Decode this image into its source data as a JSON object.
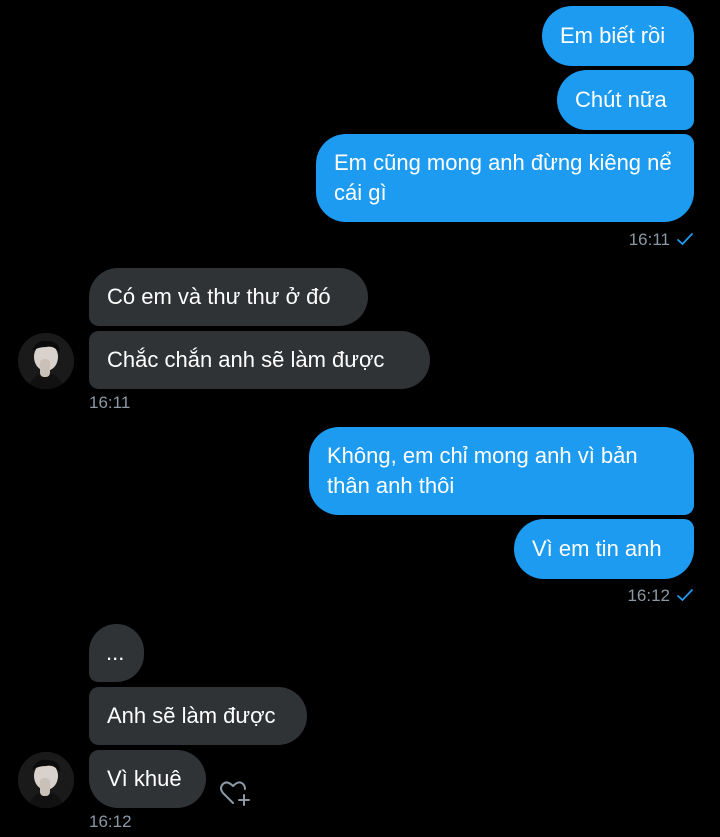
{
  "conversation": {
    "messages": [
      {
        "id": "m1",
        "from": "me",
        "text": "Em biết rồi"
      },
      {
        "id": "m2",
        "from": "me",
        "text": "Chút nữa"
      },
      {
        "id": "m3",
        "from": "me",
        "text": "Em cũng mong anh đừng kiêng nể cái gì"
      },
      {
        "id": "m4",
        "from": "them",
        "text": "Có em và thư thư ở đó"
      },
      {
        "id": "m5",
        "from": "them",
        "text": "Chắc chắn anh sẽ làm được"
      },
      {
        "id": "m6",
        "from": "me",
        "text": "Không, em chỉ mong anh vì bản thân anh thôi"
      },
      {
        "id": "m7",
        "from": "me",
        "text": "Vì em tin anh"
      },
      {
        "id": "m8",
        "from": "them",
        "text": "..."
      },
      {
        "id": "m9",
        "from": "them",
        "text": "Anh sẽ làm được"
      },
      {
        "id": "m10",
        "from": "them",
        "text": "Vì khuê"
      }
    ],
    "timestamps": {
      "group1": "16:11",
      "group2": "16:11",
      "group3": "16:12",
      "group4": "16:12"
    },
    "icons": {
      "read_receipt": "checkmark-icon",
      "avatar": "avatar",
      "reaction": "add-reaction-heart-icon"
    },
    "colors": {
      "sent_bubble": "#1d9bf0",
      "received_bubble": "#2f3336",
      "timestamp": "#8b98a5",
      "background": "#000000"
    }
  }
}
